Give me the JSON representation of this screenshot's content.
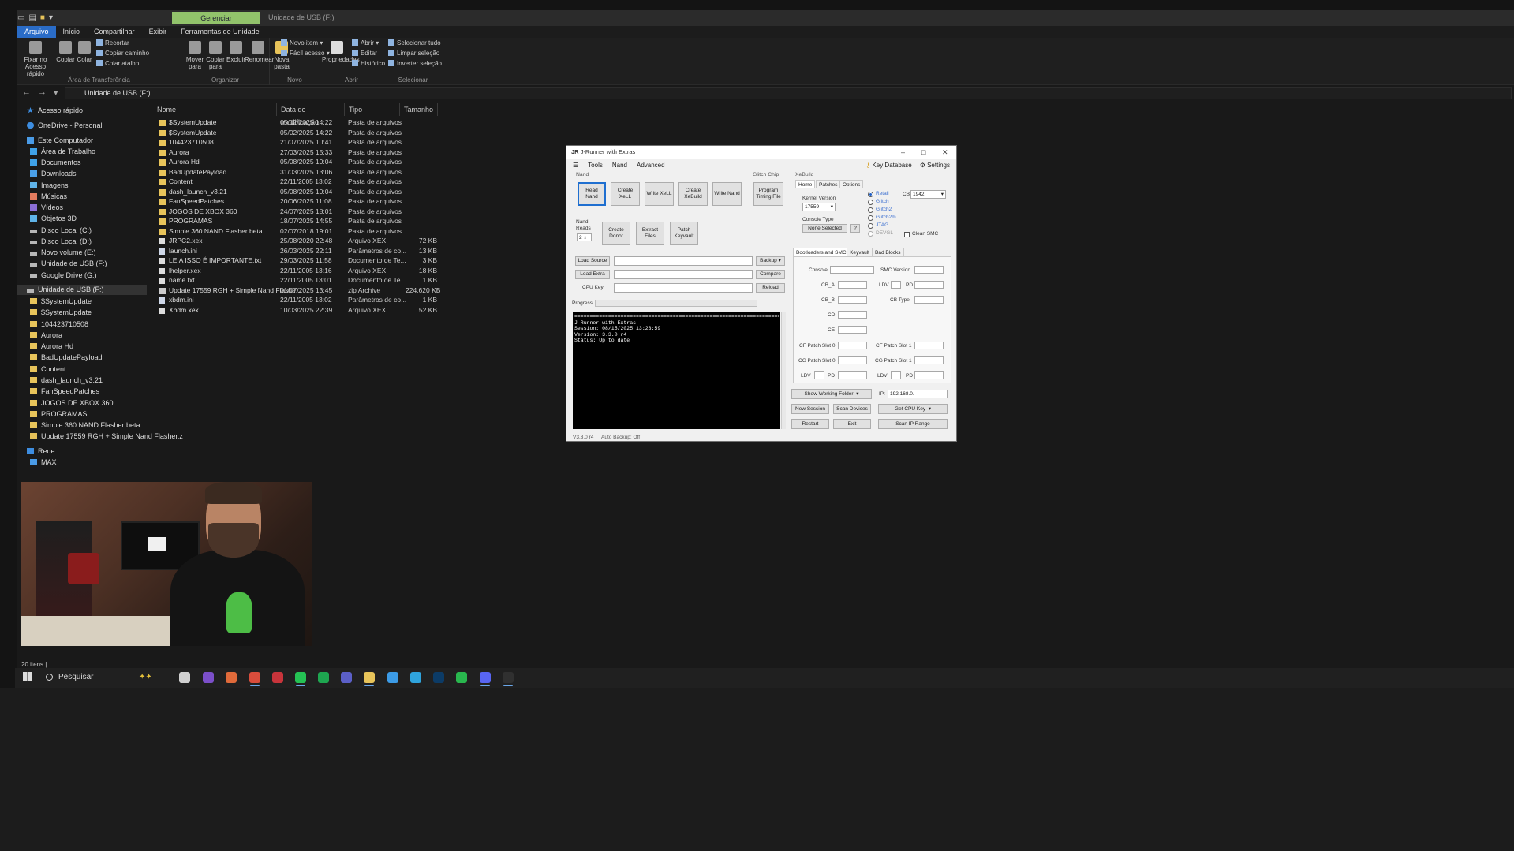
{
  "explorer": {
    "context_tab": "Gerenciar",
    "window_title": "Unidade de USB (F:)",
    "menus": [
      "Arquivo",
      "Início",
      "Compartilhar",
      "Exibir",
      "Ferramentas de Unidade"
    ],
    "ribbon": {
      "clipboard": {
        "pin": "Fixar no Acesso rápido",
        "copy": "Copiar",
        "paste": "Colar",
        "cut": "Recortar",
        "copy_path": "Copiar caminho",
        "paste_shortcut": "Colar atalho",
        "group": "Área de Transferência"
      },
      "organize": {
        "move": "Mover para",
        "copy_to": "Copiar para",
        "delete": "Excluir",
        "rename": "Renomear",
        "group": "Organizar"
      },
      "new": {
        "new_folder": "Nova pasta",
        "new_item": "Novo item",
        "easy_access": "Fácil acesso",
        "group": "Novo"
      },
      "open": {
        "properties": "Propriedades",
        "open": "Abrir",
        "edit": "Editar",
        "history": "Histórico",
        "group": "Abrir"
      },
      "select": {
        "select_all": "Selecionar tudo",
        "clear": "Limpar seleção",
        "invert": "Inverter seleção",
        "group": "Selecionar"
      }
    },
    "address": "Unidade de USB (F:)",
    "columns": [
      "Nome",
      "Data de modificação",
      "Tipo",
      "Tamanho"
    ],
    "nav": [
      {
        "label": "Acesso rápido",
        "icon": "star-icon"
      },
      {
        "label": "OneDrive - Personal",
        "icon": "cloud-icon"
      },
      {
        "label": "Este Computador",
        "icon": "computer-icon"
      },
      {
        "label": "Área de Trabalho",
        "icon": "desktop-icon"
      },
      {
        "label": "Documentos",
        "icon": "documents-icon"
      },
      {
        "label": "Downloads",
        "icon": "downloads-icon"
      },
      {
        "label": "Imagens",
        "icon": "pictures-icon"
      },
      {
        "label": "Músicas",
        "icon": "music-icon"
      },
      {
        "label": "Vídeos",
        "icon": "videos-icon"
      },
      {
        "label": "Objetos 3D",
        "icon": "objects-icon"
      },
      {
        "label": "Disco Local (C:)",
        "icon": "drive-icon"
      },
      {
        "label": "Disco Local (D:)",
        "icon": "drive-icon"
      },
      {
        "label": "Novo volume (E:)",
        "icon": "drive-icon"
      },
      {
        "label": "Unidade de USB (F:)",
        "icon": "usb-drive-icon"
      },
      {
        "label": "Google Drive (G:)",
        "icon": "google-drive-icon"
      },
      {
        "label": "Unidade de USB (F:)",
        "icon": "usb-drive-icon"
      },
      {
        "label": "$SystemUpdate",
        "icon": "folder-icon"
      },
      {
        "label": "$SystemUpdate",
        "icon": "folder-icon"
      },
      {
        "label": "104423710508",
        "icon": "folder-icon"
      },
      {
        "label": "Aurora",
        "icon": "folder-icon"
      },
      {
        "label": "Aurora Hd",
        "icon": "folder-icon"
      },
      {
        "label": "BadUpdatePayload",
        "icon": "folder-icon"
      },
      {
        "label": "Content",
        "icon": "folder-icon"
      },
      {
        "label": "dash_launch_v3.21",
        "icon": "folder-icon"
      },
      {
        "label": "FanSpeedPatches",
        "icon": "folder-icon"
      },
      {
        "label": "JOGOS DE XBOX 360",
        "icon": "folder-icon"
      },
      {
        "label": "PROGRAMAS",
        "icon": "folder-icon"
      },
      {
        "label": "Simple 360 NAND Flasher beta",
        "icon": "folder-icon"
      },
      {
        "label": "Update 17559 RGH + Simple Nand Flasher.z",
        "icon": "zip-icon"
      },
      {
        "label": "Rede",
        "icon": "network-icon"
      },
      {
        "label": "MAX",
        "icon": "computer-icon"
      }
    ],
    "files": [
      {
        "name": "$SystemUpdate",
        "date": "05/02/2025 14:22",
        "type": "Pasta de arquivos",
        "size": "",
        "kind": "folder"
      },
      {
        "name": "$SystemUpdate",
        "date": "05/02/2025 14:22",
        "type": "Pasta de arquivos",
        "size": "",
        "kind": "folder"
      },
      {
        "name": "104423710508",
        "date": "21/07/2025 10:41",
        "type": "Pasta de arquivos",
        "size": "",
        "kind": "folder"
      },
      {
        "name": "Aurora",
        "date": "27/03/2025 15:33",
        "type": "Pasta de arquivos",
        "size": "",
        "kind": "folder"
      },
      {
        "name": "Aurora Hd",
        "date": "05/08/2025 10:04",
        "type": "Pasta de arquivos",
        "size": "",
        "kind": "folder"
      },
      {
        "name": "BadUpdatePayload",
        "date": "31/03/2025 13:06",
        "type": "Pasta de arquivos",
        "size": "",
        "kind": "folder"
      },
      {
        "name": "Content",
        "date": "22/11/2005 13:02",
        "type": "Pasta de arquivos",
        "size": "",
        "kind": "folder"
      },
      {
        "name": "dash_launch_v3.21",
        "date": "05/08/2025 10:04",
        "type": "Pasta de arquivos",
        "size": "",
        "kind": "folder"
      },
      {
        "name": "FanSpeedPatches",
        "date": "20/06/2025 11:08",
        "type": "Pasta de arquivos",
        "size": "",
        "kind": "folder"
      },
      {
        "name": "JOGOS DE XBOX 360",
        "date": "24/07/2025 18:01",
        "type": "Pasta de arquivos",
        "size": "",
        "kind": "folder"
      },
      {
        "name": "PROGRAMAS",
        "date": "18/07/2025 14:55",
        "type": "Pasta de arquivos",
        "size": "",
        "kind": "folder"
      },
      {
        "name": "Simple 360 NAND Flasher beta",
        "date": "02/07/2018 19:01",
        "type": "Pasta de arquivos",
        "size": "",
        "kind": "folder"
      },
      {
        "name": "JRPC2.xex",
        "date": "25/08/2020 22:48",
        "type": "Arquivo XEX",
        "size": "72 KB",
        "kind": "file"
      },
      {
        "name": "launch.ini",
        "date": "26/03/2025 22:11",
        "type": "Parâmetros de co...",
        "size": "13 KB",
        "kind": "ini"
      },
      {
        "name": "LEIA ISSO É IMPORTANTE.txt",
        "date": "29/03/2025 11:58",
        "type": "Documento de Te...",
        "size": "3 KB",
        "kind": "file"
      },
      {
        "name": "lhelper.xex",
        "date": "22/11/2005 13:16",
        "type": "Arquivo XEX",
        "size": "18 KB",
        "kind": "file"
      },
      {
        "name": "name.txt",
        "date": "22/11/2005 13:01",
        "type": "Documento de Te...",
        "size": "1 KB",
        "kind": "file"
      },
      {
        "name": "Update 17559 RGH + Simple Nand Flashe...",
        "date": "01/07/2025 13:45",
        "type": "zip Archive",
        "size": "224.620 KB",
        "kind": "zip"
      },
      {
        "name": "xbdm.ini",
        "date": "22/11/2005 13:02",
        "type": "Parâmetros de co...",
        "size": "1 KB",
        "kind": "ini"
      },
      {
        "name": "Xbdm.xex",
        "date": "10/03/2025 22:39",
        "type": "Arquivo XEX",
        "size": "52 KB",
        "kind": "file"
      }
    ],
    "status": "20 itens"
  },
  "jrunner": {
    "title": "J-Runner with Extras",
    "menu": [
      "Tools",
      "Nand",
      "Advanced"
    ],
    "key_database": "Key Database",
    "settings": "Settings",
    "nand_group": "Nand",
    "nand_buttons": [
      "Read Nand",
      "Create XeLL",
      "Write XeLL",
      "Create XeBuild",
      "Write Nand"
    ],
    "glitch_group": "Glitch Chip",
    "program_timing": "Program Timing File",
    "nand_reads_label": "Nand Reads",
    "nand_reads_value": "2",
    "extra_buttons": [
      "Create Donor",
      "Extract Files",
      "Patch Keyvault"
    ],
    "load_source": "Load Source",
    "load_extra": "Load Extra",
    "cpu_key_label": "CPU Key",
    "backup": "Backup",
    "compare": "Compare",
    "reload": "Reload",
    "progress_label": "Progress",
    "console_lines": [
      "J-Runner with Extras",
      "Session: 08/15/2025 13:23:59",
      "Version: 3.3.0 r4",
      "Status: Up to date"
    ],
    "footer_version": "V3.3.0 r4",
    "footer_backup": "Auto Backup: Off",
    "xebuild_group": "XeBuild",
    "xebuild_tabs": [
      "Home",
      "Patches",
      "Options"
    ],
    "kernel_label": "Kernel Version",
    "kernel_value": "17559",
    "console_type_label": "Console Type",
    "console_type_value": "None Selected",
    "help_btn": "?",
    "radios": [
      "Retail",
      "Glitch",
      "Glitch2",
      "Glitch2m",
      "JTAG",
      "DEVGL"
    ],
    "cb_label": "CB",
    "cb_value": "1942",
    "clean_smc": "Clean SMC",
    "boot_tabs": [
      "Bootloaders and SMC",
      "Keyvault",
      "Bad Blocks"
    ],
    "fields": {
      "console": "Console",
      "smc_version": "SMC Version",
      "cb_a": "CB_A",
      "ldv": "LDV",
      "pd": "PD",
      "cb_b": "CB_B",
      "cb_type": "CB Type",
      "cd": "CD",
      "ce": "CE",
      "cf_slot0": "CF Patch Slot 0",
      "cf_slot1": "CF Patch Slot 1",
      "cg_slot0": "CG Patch Slot 0",
      "cg_slot1": "CG Patch Slot 1"
    },
    "show_working": "Show Working Folder",
    "ip_label": "IP:",
    "ip_value": "192.168.0.",
    "new_session": "New Session",
    "scan_devices": "Scan Devices",
    "get_cpu_key": "Get CPU Key",
    "restart": "Restart",
    "exit": "Exit",
    "scan_ip": "Scan IP Range"
  },
  "taskbar": {
    "search": "Pesquisar",
    "apps": [
      {
        "name": "task-view-icon",
        "color": "#d0d0d0"
      },
      {
        "name": "purple-app-icon",
        "color": "#7b4fc9"
      },
      {
        "name": "copilot-icon",
        "color": "#e06a3a"
      },
      {
        "name": "chrome-icon",
        "color": "#d94d3c"
      },
      {
        "name": "tool-icon",
        "color": "#c8343b"
      },
      {
        "name": "whatsapp-icon",
        "color": "#25c254"
      },
      {
        "name": "dollar-app-icon",
        "color": "#1ea650"
      },
      {
        "name": "teams-icon",
        "color": "#5b5fc7"
      },
      {
        "name": "file-explorer-icon",
        "color": "#e8c45a"
      },
      {
        "name": "chrome-alt-icon",
        "color": "#3c9be6"
      },
      {
        "name": "telegram-icon",
        "color": "#2fa3dc"
      },
      {
        "name": "photoshop-icon",
        "color": "#0c3b66"
      },
      {
        "name": "green-app-icon",
        "color": "#29b74e"
      },
      {
        "name": "discord-icon",
        "color": "#5865f2"
      },
      {
        "name": "jrunner-icon",
        "color": "#303030"
      }
    ]
  }
}
